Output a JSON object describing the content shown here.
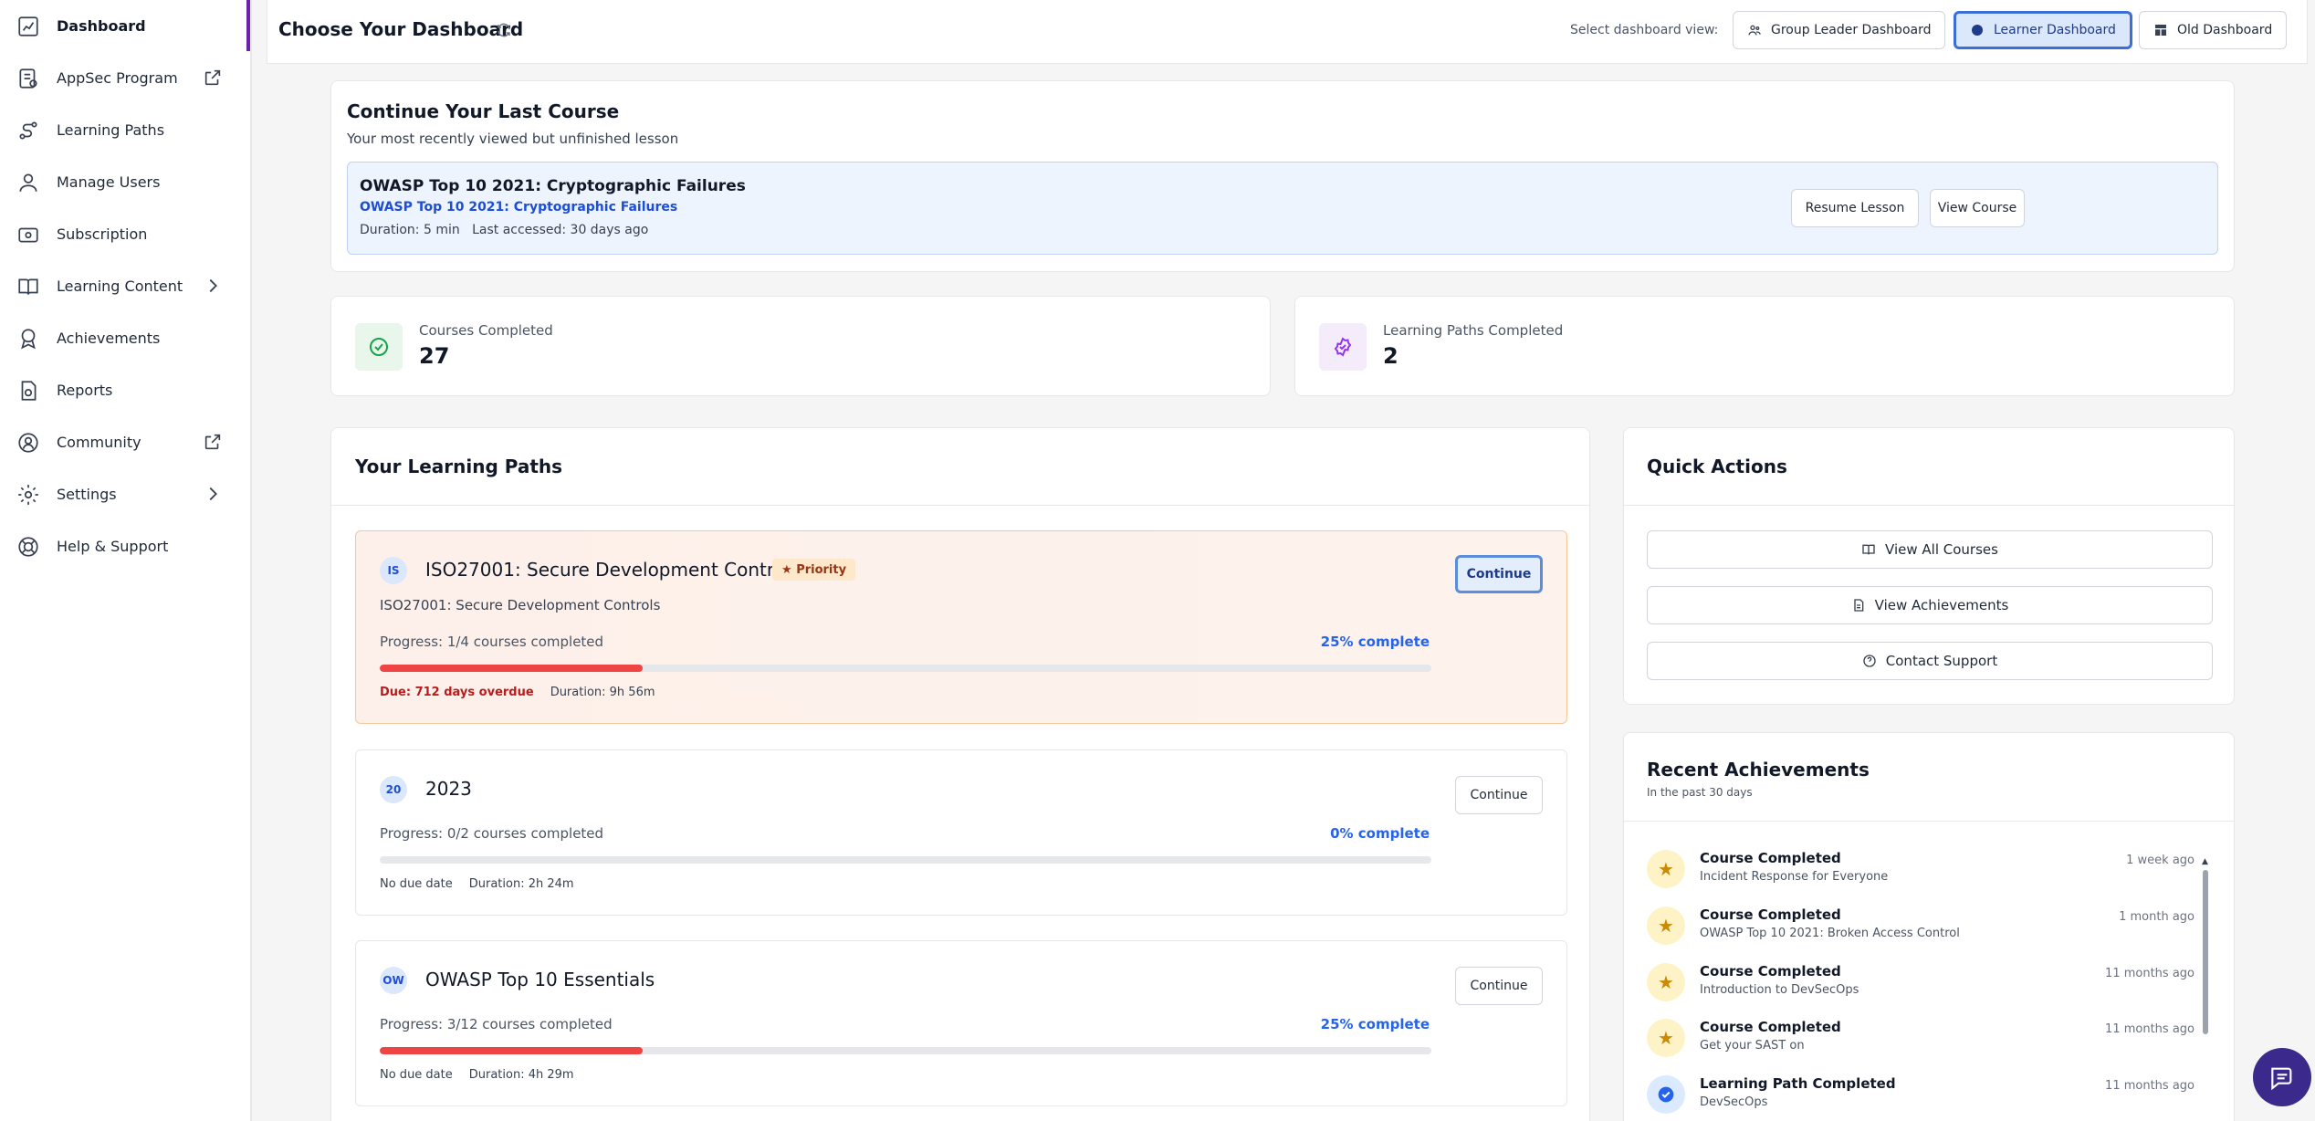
{
  "sidebar": {
    "items": [
      {
        "label": "Dashboard",
        "icon": "dashboard-icon"
      },
      {
        "label": "AppSec Program",
        "icon": "program-icon"
      },
      {
        "label": "Learning Paths",
        "icon": "paths-icon"
      },
      {
        "label": "Manage Users",
        "icon": "users-icon"
      },
      {
        "label": "Subscription",
        "icon": "subscription-icon"
      },
      {
        "label": "Learning Content",
        "icon": "book-icon"
      },
      {
        "label": "Achievements",
        "icon": "award-icon"
      },
      {
        "label": "Reports",
        "icon": "report-icon"
      },
      {
        "label": "Community",
        "icon": "community-icon"
      },
      {
        "label": "Settings",
        "icon": "gear-icon"
      },
      {
        "label": "Help & Support",
        "icon": "help-icon"
      }
    ]
  },
  "header": {
    "title": "Choose Your Dashboard",
    "view_label": "Select dashboard view:",
    "views": [
      "Group Leader Dashboard",
      "Learner Dashboard",
      "Old Dashboard"
    ],
    "selected_view": "Learner Dashboard"
  },
  "last_course": {
    "title": "Continue Your Last Course",
    "subtitle": "Your most recently viewed but unfinished lesson",
    "lesson_title": "OWASP Top 10 2021: Cryptographic Failures",
    "course_link": "OWASP Top 10 2021: Cryptographic Failures",
    "meta": "Duration: 5 min   Last accessed: 30 days ago",
    "resume_label": "Resume Lesson",
    "view_label": "View Course"
  },
  "stats": [
    {
      "label": "Courses Completed",
      "value": "27",
      "color": "#16a34a"
    },
    {
      "label": "Learning Paths Completed",
      "value": "2",
      "color": "#9333ea"
    }
  ],
  "learning_paths": {
    "title": "Your Learning Paths",
    "items": [
      {
        "badge": "IS",
        "name": "ISO27001: Secure Development Controls",
        "priority": "Priority",
        "description": "ISO27001: Secure Development Controls",
        "progress_text": "Progress: 1/4 courses completed",
        "percent_text": "25% complete",
        "progress": 0.25,
        "due": "Due: 712 days overdue",
        "duration": "Duration: 9h 56m",
        "action": "Continue"
      },
      {
        "badge": "20",
        "name": "2023",
        "progress_text": "Progress: 0/2 courses completed",
        "percent_text": "0% complete",
        "progress": 0,
        "due": "No due date",
        "duration": "Duration: 2h 24m",
        "action": "Continue"
      },
      {
        "badge": "OW",
        "name": "OWASP Top 10 Essentials",
        "progress_text": "Progress: 3/12 courses completed",
        "percent_text": "25% complete",
        "progress": 0.25,
        "due": "No due date",
        "duration": "Duration: 4h 29m",
        "action": "Continue"
      }
    ]
  },
  "quick_actions": {
    "title": "Quick Actions",
    "items": [
      {
        "label": "View All Courses",
        "icon": "book-open-icon"
      },
      {
        "label": "View Achievements",
        "icon": "file-icon"
      },
      {
        "label": "Contact Support",
        "icon": "help-circle-icon"
      }
    ]
  },
  "recent_achievements": {
    "title": "Recent Achievements",
    "subtitle": "In the past 30 days",
    "items": [
      {
        "title": "Course Completed",
        "detail": "Incident Response for Everyone",
        "time": "1 week ago",
        "icon": "star-icon"
      },
      {
        "title": "Course Completed",
        "detail": "OWASP Top 10 2021: Broken Access Control",
        "time": "1 month ago",
        "icon": "star-icon"
      },
      {
        "title": "Course Completed",
        "detail": "Introduction to DevSecOps",
        "time": "11 months ago",
        "icon": "star-icon"
      },
      {
        "title": "Course Completed",
        "detail": "Get your SAST on",
        "time": "11 months ago",
        "icon": "star-icon"
      },
      {
        "title": "Learning Path Completed",
        "detail": "DevSecOps",
        "time": "11 months ago",
        "icon": "check-circle-icon"
      }
    ]
  },
  "colors": {
    "accent": "#6b21a8",
    "primary": "#2563eb",
    "progress": "#ef4444",
    "chat": "#3b2a8c"
  }
}
